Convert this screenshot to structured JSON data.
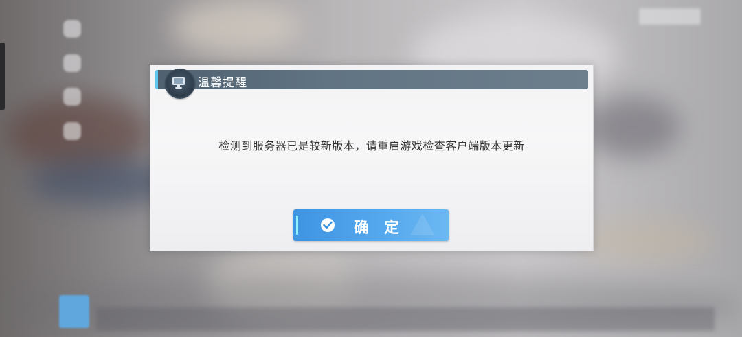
{
  "dialog": {
    "title": "温馨提醒",
    "message": "检测到服务器已是较新版本，请重启游戏检查客户端版本更新",
    "confirm_label": "确定",
    "title_icon": "monitor-icon",
    "confirm_icon": "check-circle-icon"
  },
  "colors": {
    "titlebar": "#5a6c7b",
    "button": "#4aa0ea",
    "accent": "#5cc6ef"
  }
}
